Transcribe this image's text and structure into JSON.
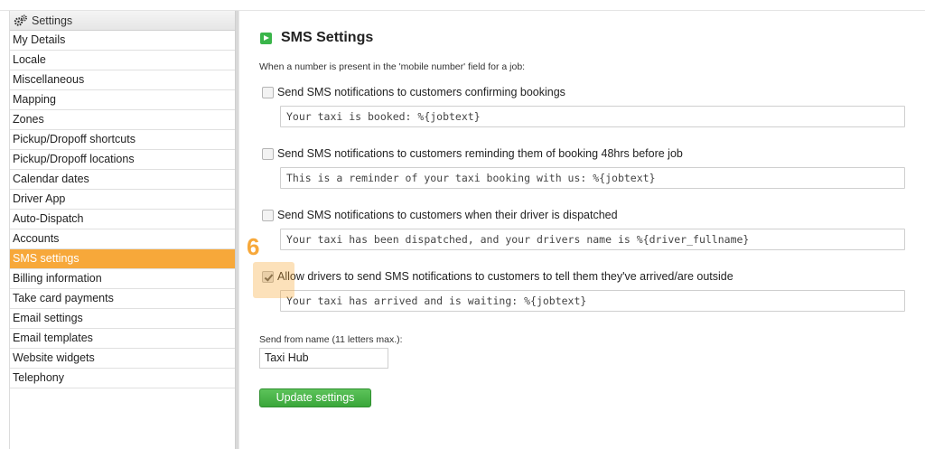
{
  "sidebar": {
    "header": "Settings",
    "items": [
      {
        "label": "My Details"
      },
      {
        "label": "Locale"
      },
      {
        "label": "Miscellaneous"
      },
      {
        "label": "Mapping"
      },
      {
        "label": "Zones"
      },
      {
        "label": "Pickup/Dropoff shortcuts"
      },
      {
        "label": "Pickup/Dropoff locations"
      },
      {
        "label": "Calendar dates"
      },
      {
        "label": "Driver App"
      },
      {
        "label": "Auto-Dispatch"
      },
      {
        "label": "Accounts"
      },
      {
        "label": "SMS settings",
        "active": true
      },
      {
        "label": "Billing information"
      },
      {
        "label": "Take card payments"
      },
      {
        "label": "Email settings"
      },
      {
        "label": "Email templates"
      },
      {
        "label": "Website widgets"
      },
      {
        "label": "Telephony"
      }
    ]
  },
  "main": {
    "title": "SMS Settings",
    "intro": "When a number is present in the 'mobile number' field for a job:",
    "options": [
      {
        "label": "Send SMS notifications to customers confirming bookings",
        "checked": false,
        "message": "Your taxi is booked: %{jobtext}"
      },
      {
        "label": "Send SMS notifications to customers reminding them of booking 48hrs before job",
        "checked": false,
        "message": "This is a reminder of your taxi booking with us: %{jobtext}"
      },
      {
        "label": "Send SMS notifications to customers when their driver is dispatched",
        "checked": false,
        "message": "Your taxi has been dispatched, and your drivers name is %{driver_fullname}"
      },
      {
        "label": "Allow drivers to send SMS notifications to customers to tell them they've arrived/are outside",
        "checked": true,
        "message": "Your taxi has arrived and is waiting: %{jobtext}"
      }
    ],
    "step_number": "6",
    "from_name": {
      "label": "Send from name (11 letters max.):",
      "value": "Taxi Hub"
    },
    "update_button": "Update settings"
  },
  "colors": {
    "accent": "#f7a83a",
    "button_green": "#3aa63a",
    "sms_icon": "#3ab54a"
  },
  "icons": {
    "sidebar_header": "gears-icon",
    "title": "sms-play-icon"
  }
}
